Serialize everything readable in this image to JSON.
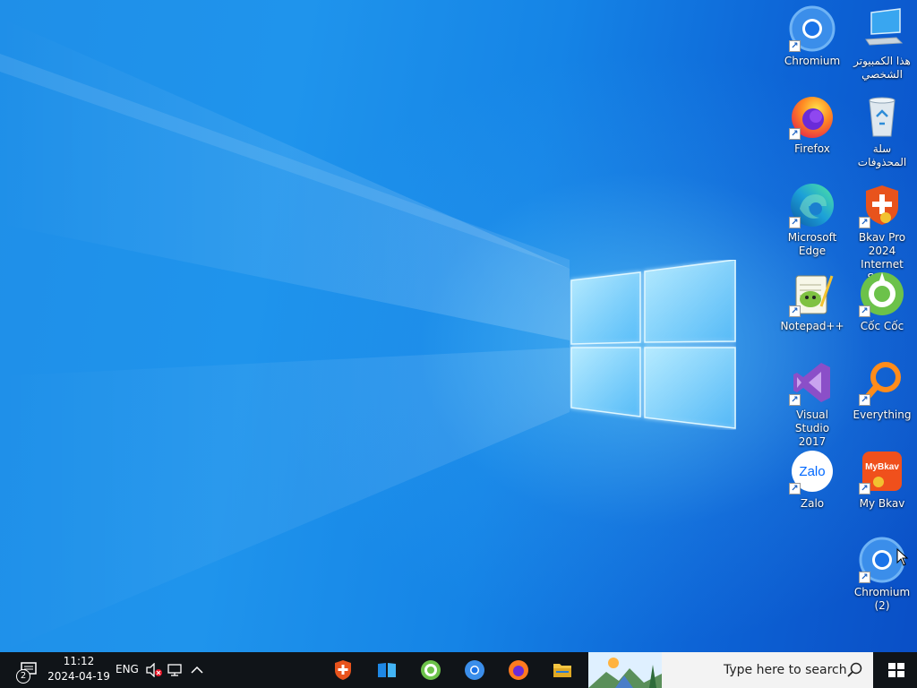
{
  "desktop": {
    "icons": [
      {
        "label": "Chromium",
        "label2": "",
        "icon": "chromium-icon"
      },
      {
        "label": "هذا الكمبيوتر",
        "label2": "الشخصي",
        "icon": "computer-icon"
      },
      {
        "label": "Firefox",
        "label2": "",
        "icon": "firefox-icon"
      },
      {
        "label": "سلة",
        "label2": "المحذوفات",
        "icon": "recycle-bin-icon"
      },
      {
        "label": "Microsoft",
        "label2": "Edge",
        "icon": "edge-icon"
      },
      {
        "label": "Bkav Pro 2024",
        "label2": "Internet Sec...",
        "icon": "bkav-icon"
      },
      {
        "label": "Notepad++",
        "label2": "",
        "icon": "notepad-plus-plus-icon"
      },
      {
        "label": "Cốc Cốc",
        "label2": "",
        "icon": "coccoc-icon"
      },
      {
        "label": "Visual Studio",
        "label2": "2017",
        "icon": "visual-studio-icon"
      },
      {
        "label": "Everything",
        "label2": "",
        "icon": "everything-icon"
      },
      {
        "label": "Zalo",
        "label2": "",
        "icon": "zalo-icon"
      },
      {
        "label": "My Bkav",
        "label2": "",
        "icon": "mybkav-icon"
      },
      {
        "label": "Chromium",
        "label2": "(2)",
        "icon": "chromium-icon"
      }
    ],
    "zalo_text": "Zalo",
    "mybkav_text": "MyBkav",
    "shortcut_glyph": "↗"
  },
  "taskbar": {
    "notification_count": "2",
    "time": "11:12",
    "date": "2024-04-19",
    "language": "ENG",
    "search_placeholder": "Type here to search",
    "apps": [
      "bkav",
      "file-viewer",
      "coccoc",
      "chromium",
      "firefox",
      "file-explorer"
    ]
  },
  "colors": {
    "taskbar": "#101418",
    "desktop_blue": "#1f8fe8",
    "search_box": "#f3f3f3"
  }
}
